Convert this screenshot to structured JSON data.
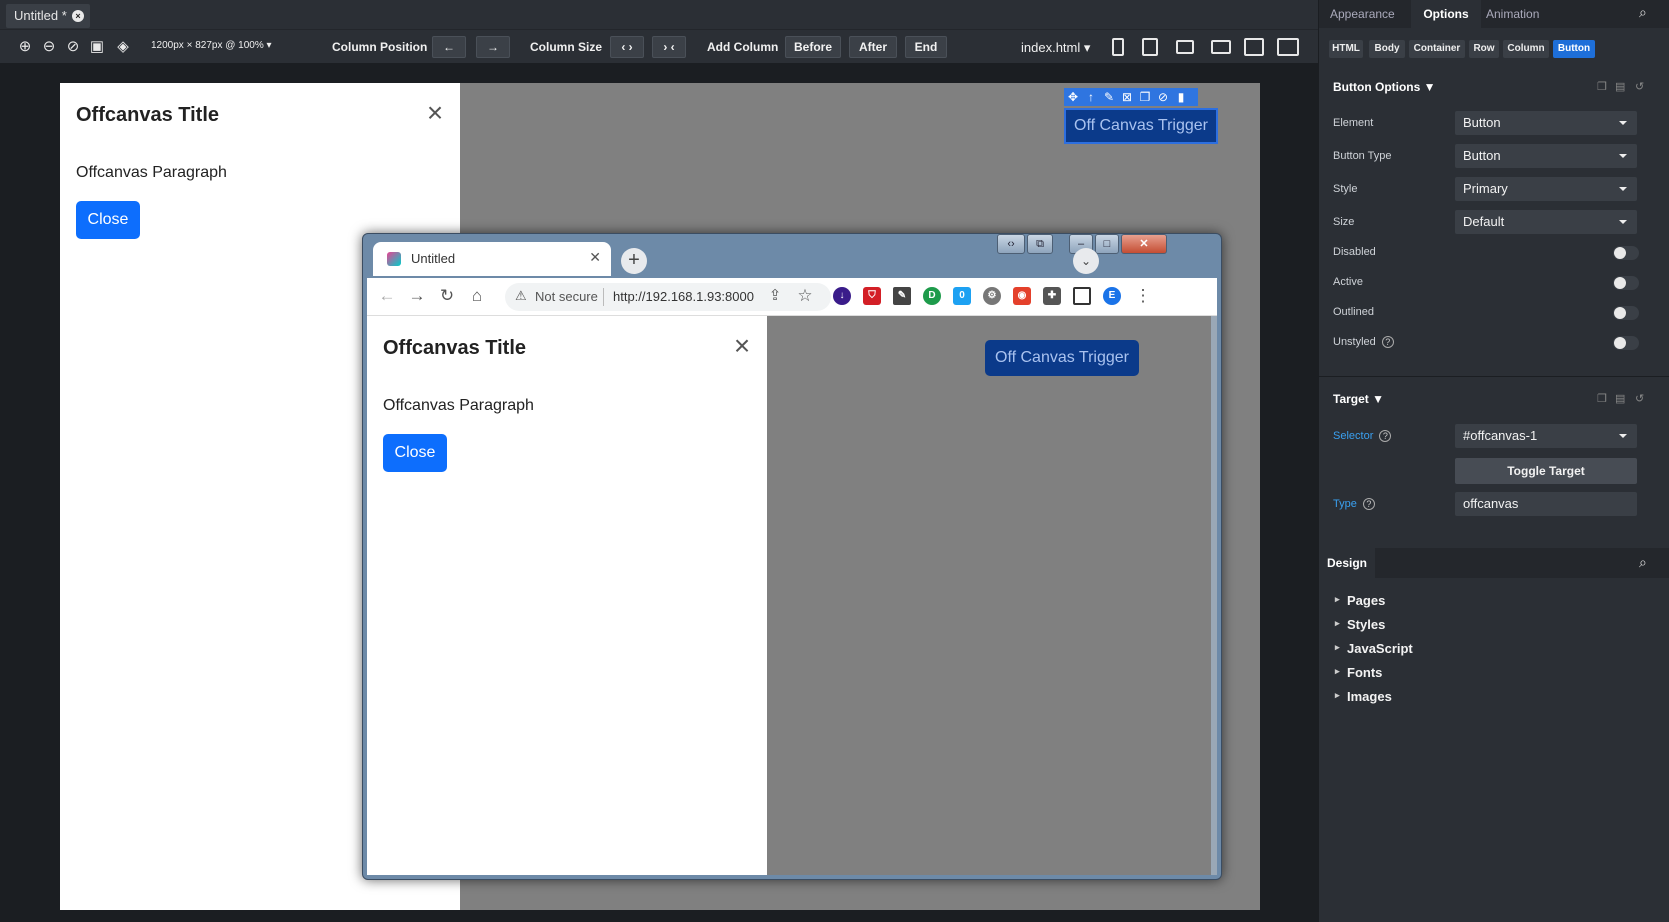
{
  "doc_tab": {
    "label": "Untitled *",
    "close": "×"
  },
  "toolbar": {
    "size_label": "1200px × 827px @ 100% ▾",
    "column_position": "Column Position",
    "column_size": "Column Size",
    "add_column": "Add Column",
    "before": "Before",
    "after": "After",
    "end": "End",
    "file": "index.html ▾",
    "left_arrow": "←",
    "right_arrow": "→",
    "grow": "‹ ›",
    "shrink": "› ‹"
  },
  "stage": {
    "offcanvas_title": "Offcanvas Title",
    "offcanvas_paragraph": "Offcanvas Paragraph",
    "close_button": "Close",
    "trigger_button": "Off Canvas Trigger",
    "close_x": "×"
  },
  "browser": {
    "tab_title": "Untitled",
    "not_secure": "Not secure",
    "url": "http://192.168.1.93:8000",
    "profile_letter": "E"
  },
  "panel": {
    "tabs": [
      "Appearance",
      "Options",
      "Animation"
    ],
    "breadcrumbs": [
      "HTML",
      "Body",
      "Container",
      "Row",
      "Column",
      "Button"
    ],
    "button_options": {
      "title": "Button Options ▼",
      "element_label": "Element",
      "element_value": "Button",
      "button_type_label": "Button Type",
      "button_type_value": "Button",
      "style_label": "Style",
      "style_value": "Primary",
      "size_label": "Size",
      "size_value": "Default",
      "disabled": "Disabled",
      "active": "Active",
      "outlined": "Outlined",
      "unstyled": "Unstyled"
    },
    "target": {
      "title": "Target ▼",
      "selector_label": "Selector",
      "selector_value": "#offcanvas-1",
      "toggle_target": "Toggle Target",
      "type_label": "Type",
      "type_value": "offcanvas"
    },
    "design": {
      "title": "Design",
      "items": [
        "Pages",
        "Styles",
        "JavaScript",
        "Fonts",
        "Images"
      ]
    }
  },
  "colors": {
    "primary": "#0d6efd",
    "accent": "#2f75e0",
    "link": "#3aa0f0"
  }
}
